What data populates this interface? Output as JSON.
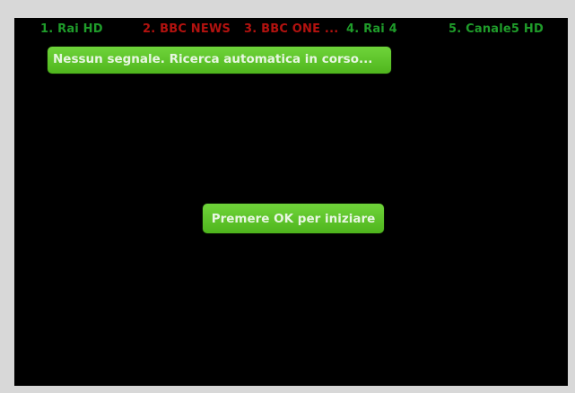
{
  "channels": [
    {
      "label": "1. Rai HD",
      "color": "#1f9c2a"
    },
    {
      "label": "2. BBC NEWS",
      "color": "#b3120f"
    },
    {
      "label": "3. BBC ONE ...",
      "color": "#b3120f"
    },
    {
      "label": "4. Rai 4",
      "color": "#1f9c2a"
    },
    {
      "label": "5. Canale5 HD",
      "color": "#1f9c2a"
    }
  ],
  "banner": {
    "message": "Nessun segnale. Ricerca automatica in corso..."
  },
  "ok_prompt": {
    "label": "Premere OK per iniziare"
  },
  "colors": {
    "accent_green": "#5cc42a",
    "text_light": "#e8f6e2",
    "background": "#000000",
    "frame": "#d8d8d8"
  }
}
